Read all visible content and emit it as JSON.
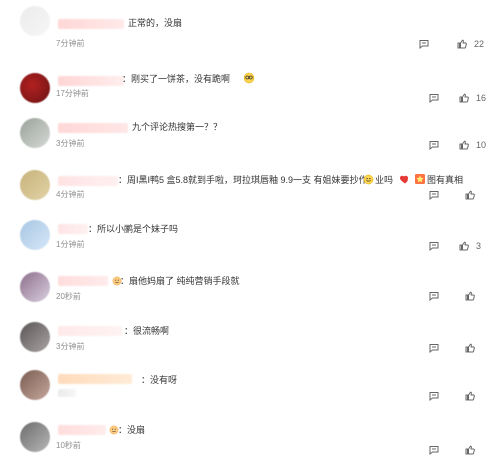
{
  "comments": [
    {
      "id": "c1",
      "text": "正常的，没扇",
      "time": "7分钟前",
      "likes": "22",
      "avatar_colors": [
        "#ececec",
        "#f5f5f5"
      ],
      "name_colors": [
        "#ffd2d2",
        "#ffe7e7"
      ],
      "emoji": []
    },
    {
      "id": "c2",
      "text": "：刚买了一饼茶，没有跪啊",
      "time": "17分钟前",
      "likes": "16",
      "avatar_colors": [
        "#6b1313",
        "#b22020"
      ],
      "name_colors": [
        "#ffd1d1",
        "#ffecec"
      ],
      "emoji": [
        "glasses-emoji"
      ]
    },
    {
      "id": "c3",
      "text": "九个评论热搜第一？？",
      "time": "3分钟前",
      "likes": "10",
      "avatar_colors": [
        "#9aa29a",
        "#d6d9d6"
      ],
      "name_colors": [
        "#ffd3d3",
        "#ffe4e4"
      ],
      "emoji": []
    },
    {
      "id": "c4",
      "text": "：周I黑I鸭5 盒5.8就到手啦，珂拉琪唇釉 9.9一支 有姐妹要抄作",
      "text2": "业吗",
      "text3": "图有真相",
      "time": "4分钟前",
      "likes": "",
      "avatar_colors": [
        "#c7b27b",
        "#e2d3a6"
      ],
      "name_colors": [
        "#ffe0e0",
        "#ffeeee"
      ],
      "emoji": [
        "face-emoji",
        "heart-emoji",
        "star-emoji"
      ]
    },
    {
      "id": "c5",
      "text": "：所以小鹂是个妹子吗",
      "time": "1分钟前",
      "likes": "3",
      "avatar_colors": [
        "#a8c6e4",
        "#d6e8f7"
      ],
      "name_colors": [
        "#ffe1e1",
        "#fff0f0"
      ],
      "emoji": []
    },
    {
      "id": "c6",
      "text": "：扇他妈扇了 纯纯营销手段就",
      "time": "20秒前",
      "likes": "",
      "avatar_colors": [
        "#8d6f8b",
        "#d9cfe0"
      ],
      "name_colors": [
        "#ffd9d9",
        "#ffeaea"
      ],
      "emoji": [
        "small-emoji"
      ]
    },
    {
      "id": "c7",
      "text": "：很流畅啊",
      "time": "3分钟前",
      "likes": "",
      "avatar_colors": [
        "#5b5656",
        "#a9a3a3"
      ],
      "name_colors": [
        "#ffe6e6",
        "#fff2f2"
      ],
      "emoji": []
    },
    {
      "id": "c8",
      "text": "：没有呀",
      "time": "",
      "likes": "",
      "avatar_colors": [
        "#7a5d52",
        "#c6a79c"
      ],
      "name_colors": [
        "#ffd7b5",
        "#ffe9d3"
      ],
      "emoji": []
    },
    {
      "id": "c9",
      "text": "：没扇",
      "time": "10秒前",
      "likes": "",
      "avatar_colors": [
        "#6c6c6c",
        "#b7b7b7"
      ],
      "name_colors": [
        "#ffd9d9",
        "#ffeaea"
      ],
      "emoji": [
        "small-emoji"
      ]
    }
  ],
  "ui": {
    "reply_icon": "comment-icon",
    "like_icon": "thumbs-up-icon",
    "accent": "#f56c6c"
  }
}
